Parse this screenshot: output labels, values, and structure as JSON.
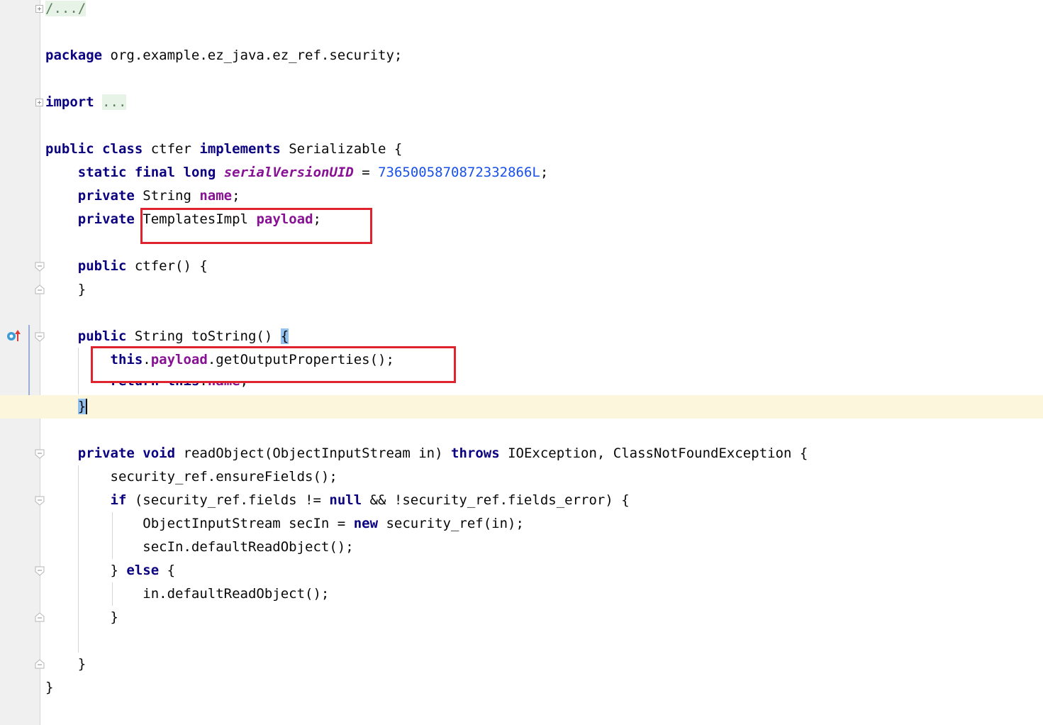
{
  "editor": {
    "lines": [
      {
        "tokens": [
          {
            "t": "/.../",
            "c": "fold-bg"
          }
        ]
      },
      {
        "tokens": []
      },
      {
        "tokens": [
          {
            "t": "package",
            "c": "kw"
          },
          {
            "t": " org.example.ez_java.ez_ref.security;"
          }
        ]
      },
      {
        "tokens": []
      },
      {
        "tokens": [
          {
            "t": "import",
            "c": "kw"
          },
          {
            "t": " "
          },
          {
            "t": "...",
            "c": "fold-bg"
          }
        ]
      },
      {
        "tokens": []
      },
      {
        "tokens": [
          {
            "t": "public",
            "c": "kw"
          },
          {
            "t": " "
          },
          {
            "t": "class",
            "c": "kw"
          },
          {
            "t": " ctfer "
          },
          {
            "t": "implements",
            "c": "kw"
          },
          {
            "t": " Serializable {"
          }
        ]
      },
      {
        "tokens": [
          {
            "t": "    "
          },
          {
            "t": "static",
            "c": "kw"
          },
          {
            "t": " "
          },
          {
            "t": "final",
            "c": "kw"
          },
          {
            "t": " "
          },
          {
            "t": "long",
            "c": "kw"
          },
          {
            "t": " "
          },
          {
            "t": "serialVersionUID",
            "c": "sfld"
          },
          {
            "t": " = "
          },
          {
            "t": "7365005870872332866L",
            "c": "num"
          },
          {
            "t": ";"
          }
        ]
      },
      {
        "tokens": [
          {
            "t": "    "
          },
          {
            "t": "private",
            "c": "kw"
          },
          {
            "t": " String "
          },
          {
            "t": "name",
            "c": "fld"
          },
          {
            "t": ";"
          }
        ]
      },
      {
        "tokens": [
          {
            "t": "    "
          },
          {
            "t": "private",
            "c": "kw"
          },
          {
            "t": " TemplatesImpl "
          },
          {
            "t": "payload",
            "c": "fld"
          },
          {
            "t": ";"
          }
        ]
      },
      {
        "tokens": []
      },
      {
        "tokens": [
          {
            "t": "    "
          },
          {
            "t": "public",
            "c": "kw"
          },
          {
            "t": " ctfer() {"
          }
        ]
      },
      {
        "tokens": [
          {
            "t": "    }"
          }
        ]
      },
      {
        "tokens": []
      },
      {
        "tokens": [
          {
            "t": "    "
          },
          {
            "t": "public",
            "c": "kw"
          },
          {
            "t": " String toString() "
          },
          {
            "t": "{",
            "c": "brace-hl"
          }
        ]
      },
      {
        "tokens": [
          {
            "t": "        "
          },
          {
            "t": "this",
            "c": "kw"
          },
          {
            "t": "."
          },
          {
            "t": "payload",
            "c": "fld"
          },
          {
            "t": ".getOutputProperties();"
          }
        ]
      },
      {
        "tokens": []
      },
      {
        "tokens": [
          {
            "t": "    "
          },
          {
            "t": "}",
            "c": "brace-hl caret"
          }
        ],
        "current": true
      },
      {
        "tokens": []
      },
      {
        "tokens": [
          {
            "t": "    "
          },
          {
            "t": "private",
            "c": "kw"
          },
          {
            "t": " "
          },
          {
            "t": "void",
            "c": "kw"
          },
          {
            "t": " readObject(ObjectInputStream in) "
          },
          {
            "t": "throws",
            "c": "kw"
          },
          {
            "t": " IOException, ClassNotFoundException {"
          }
        ]
      },
      {
        "tokens": [
          {
            "t": "        security_ref.ensureFields();"
          }
        ]
      },
      {
        "tokens": [
          {
            "t": "        "
          },
          {
            "t": "if",
            "c": "kw"
          },
          {
            "t": " (security_ref.fields != "
          },
          {
            "t": "null",
            "c": "kw"
          },
          {
            "t": " && !security_ref.fields_error) {"
          }
        ]
      },
      {
        "tokens": [
          {
            "t": "            ObjectInputStream secIn = "
          },
          {
            "t": "new",
            "c": "kw"
          },
          {
            "t": " security_ref(in);"
          }
        ]
      },
      {
        "tokens": [
          {
            "t": "            secIn.defaultReadObject();"
          }
        ]
      },
      {
        "tokens": [
          {
            "t": "        } "
          },
          {
            "t": "else",
            "c": "kw"
          },
          {
            "t": " {"
          }
        ]
      },
      {
        "tokens": [
          {
            "t": "            in.defaultReadObject();"
          }
        ]
      },
      {
        "tokens": [
          {
            "t": "        }"
          }
        ]
      },
      {
        "tokens": []
      },
      {
        "tokens": [
          {
            "t": "    }"
          }
        ]
      },
      {
        "tokens": [
          {
            "t": "}"
          }
        ]
      }
    ],
    "overlapped_line": {
      "prefix": "        ",
      "parts": [
        {
          "t": "return",
          "c": "kw"
        },
        {
          "t": " "
        },
        {
          "t": "this",
          "c": "kw"
        },
        {
          "t": "."
        },
        {
          "t": "name",
          "c": "fld"
        },
        {
          "t": ";"
        }
      ]
    }
  },
  "gutter": {
    "icons": [
      "fold-icon",
      "override-icon",
      "lightbulb-icon"
    ]
  },
  "colors": {
    "keyword": "#0a0080",
    "field": "#871094",
    "number": "#1750eb",
    "highlight_box": "#e0242f",
    "current_line": "#fcf7dc",
    "gutter": "#f0f0f0"
  }
}
